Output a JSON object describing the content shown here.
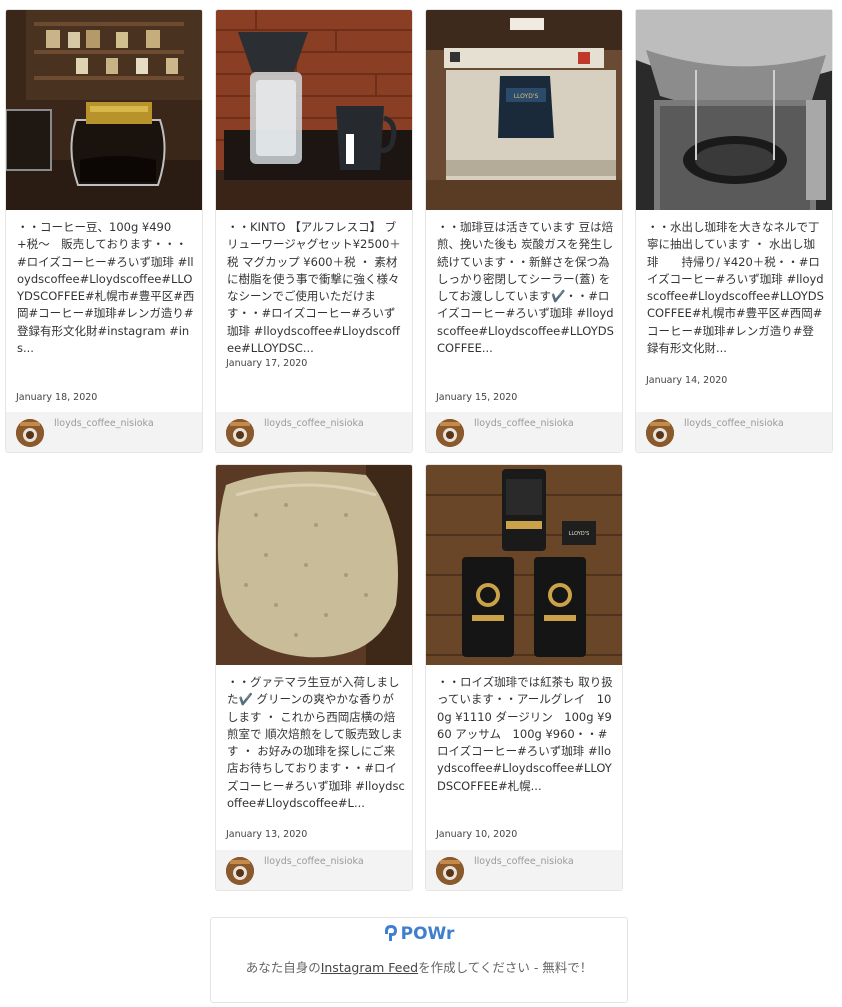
{
  "posts": [
    {
      "caption": "・・コーヒー豆、100g ¥490+税〜　販売しております・・・#ロイズコーヒー#ろいず珈琲 #lloydscoffee#Lloydscoffee#LLOYDSCOFFEE#札幌市#豊平区#西岡#コーヒー#珈琲#レンガ造り#登録有形文化財#instagram #ins...",
      "date": "January 18, 2020",
      "username": "lloyds_coffee_nisioka",
      "photo_subject": "coffee-server-on-shelf"
    },
    {
      "caption": "・・KINTO 【アルフレスコ】 ブリューワージャグセット¥2500＋税 マグカップ ¥600＋税 ・ 素材に樹脂を使う事で衝撃に強く様々なシーンでご使用いただけます・・#ロイズコーヒー#ろいず珈琲 #lloydscoffee#Lloydscoffee#LLOYDSC...",
      "date": "January 17, 2020",
      "username": "lloyds_coffee_nisioka",
      "photo_subject": "kinto-brewer-and-mug"
    },
    {
      "caption": "・・珈琲豆は活きています 豆は焙煎、挽いた後も 炭酸ガスを発生し続けています・・新鮮さを保つ為 しっかり密閉してシーラー(蓋) をしてお渡ししています✔️・・#ロイズコーヒー#ろいず珈琲 #lloydscoffee#Lloydscoffee#LLOYDSCOFFEE...",
      "date": "January 15, 2020",
      "username": "lloyds_coffee_nisioka",
      "photo_subject": "bag-sealer"
    },
    {
      "caption": "・・水出し珈琲を大きなネルで丁寧に抽出しています ・ 水出し珈琲　　持帰り/ ¥420＋税・・#ロイズコーヒー#ろいず珈琲 #lloydscoffee#Lloydscoffee#LLOYDSCOFFEE#札幌市#豊平区#西岡#コーヒー#珈琲#レンガ造り#登録有形文化財...",
      "date": "January 14, 2020",
      "username": "lloyds_coffee_nisioka",
      "photo_subject": "cloth-drip-pot"
    },
    {
      "caption": "・・グァテマラ生豆が入荷しました✔️ グリーンの爽やかな香りがします ・ これから西岡店横の焙煎室で 順次焙煎をして販売致します ・ お好みの珈琲を探しにご来店お待ちしております・・#ロイズコーヒー#ろいず珈琲 #lloydscoffee#Lloydscoffee#L...",
      "date": "January 13, 2020",
      "username": "lloyds_coffee_nisioka",
      "photo_subject": "green-beans-bag"
    },
    {
      "caption": "・・ロイズ珈琲では紅茶も 取り扱っています・・アールグレイ　100g ¥1110 ダージリン　100g ¥960 アッサム　100g ¥960・・#ロイズコーヒー#ろいず珈琲 #lloydscoffee#Lloydscoffee#LLOYDSCOFFEE#札幌...",
      "date": "January 10, 2020",
      "username": "lloyds_coffee_nisioka",
      "photo_subject": "tea-packages"
    }
  ],
  "powr": {
    "logo_text": "POWr",
    "cta_prefix": "あなた自身の",
    "cta_link": "Instagram Feed",
    "cta_suffix": "を作成してください - 無料で！"
  },
  "colors": {
    "powr_blue": "#3f7fcf",
    "card_border": "#e6e6e6",
    "footer_bg": "#f3f3f3"
  }
}
